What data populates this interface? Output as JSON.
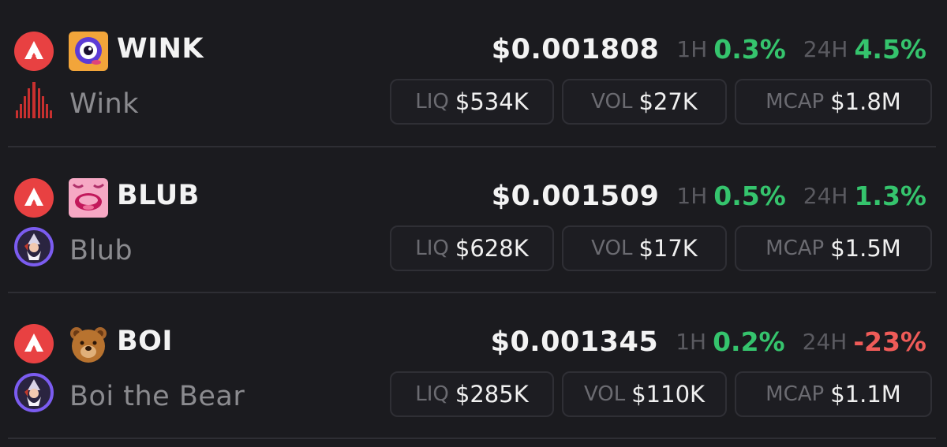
{
  "tokens": [
    {
      "symbol": "WINK",
      "name": "Wink",
      "price": "$0.001808",
      "h1_label": "1H",
      "h1_change": "0.3%",
      "h24_label": "24H",
      "h24_change": "4.5%",
      "liq_label": "LIQ",
      "liq": "$534K",
      "vol_label": "VOL",
      "vol": "$27K",
      "mcap_label": "MCAP",
      "mcap": "$1.8M"
    },
    {
      "symbol": "BLUB",
      "name": "Blub",
      "price": "$0.001509",
      "h1_label": "1H",
      "h1_change": "0.5%",
      "h24_label": "24H",
      "h24_change": "1.3%",
      "liq_label": "LIQ",
      "liq": "$628K",
      "vol_label": "VOL",
      "vol": "$17K",
      "mcap_label": "MCAP",
      "mcap": "$1.5M"
    },
    {
      "symbol": "BOI",
      "name": "Boi the Bear",
      "price": "$0.001345",
      "h1_label": "1H",
      "h1_change": "0.2%",
      "h24_label": "24H",
      "h24_change": "-23%",
      "liq_label": "LIQ",
      "liq": "$285K",
      "vol_label": "VOL",
      "vol": "$110K",
      "mcap_label": "MCAP",
      "mcap": "$1.1M"
    }
  ],
  "icons": {
    "chain": "avalanche-icon",
    "wink_logo": "wink-eye-icon",
    "blub_logo": "blub-face-icon",
    "boi_logo": "bear-face-icon",
    "dex_wink": "red-spikes-icon",
    "dex_wizard": "wizard-icon"
  },
  "colors": {
    "background": "#1b1b1f",
    "positive": "#35c46d",
    "negative": "#ef5b58",
    "avalanche": "#e84142"
  }
}
